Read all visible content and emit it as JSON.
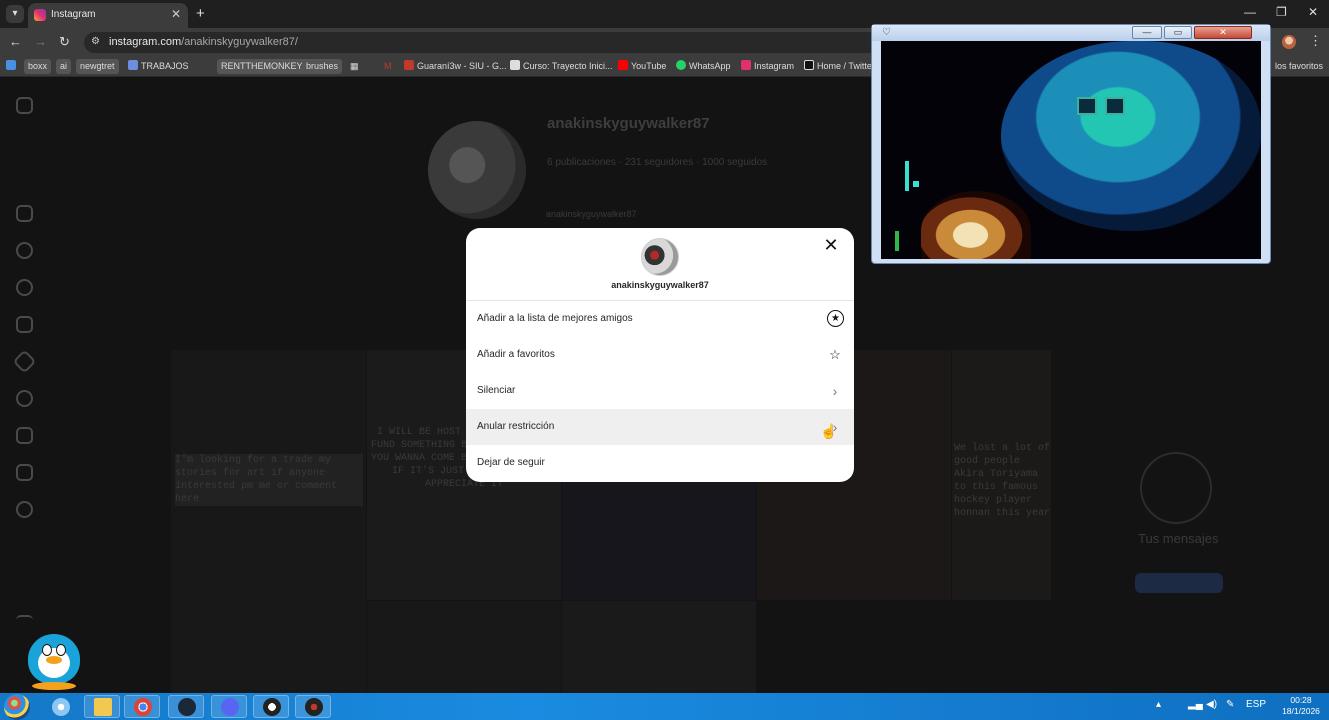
{
  "browser": {
    "tab_title": "Instagram",
    "url_host": "instagram.com",
    "url_path": "/anakinskyguywalker87/",
    "bookmarks": [
      {
        "label": "boxx",
        "chip": true,
        "color": "#3d7bd9"
      },
      {
        "label": "ai",
        "chip": true,
        "color": "#555"
      },
      {
        "label": "newgtret",
        "chip": true,
        "color": "#555"
      },
      {
        "label": "TRABAJOS",
        "chip": false,
        "color": "#6d8ddf"
      },
      {
        "label": "RENTTHEMONKEY",
        "chip": true,
        "color": "#ddd"
      },
      {
        "label": "brushes",
        "chip": true,
        "color": "#555"
      },
      {
        "label": "Guaraní3w - SIU - G...",
        "chip": false,
        "color": "#c0392b"
      },
      {
        "label": "Curso: Trayecto Inici...",
        "chip": false,
        "color": "#ddd"
      },
      {
        "label": "YouTube",
        "chip": false,
        "color": "#ff0000"
      },
      {
        "label": "WhatsApp",
        "chip": false,
        "color": "#25d366"
      },
      {
        "label": "Instagram",
        "chip": false,
        "color": "#e1306c"
      },
      {
        "label": "Home / Twitte",
        "chip": false,
        "color": "#111"
      }
    ],
    "bookmarks_overflow": "los favoritos"
  },
  "profile_bg": {
    "username": "anakinskyguywalker87",
    "stats": "6 publicaciones · 231 seguidores · 1000 seguidos",
    "highlight": "anakinskyguywalker87"
  },
  "grid_texts": {
    "post1": "I'm looking for a trade my stories for art if anyone interested pm me or comment here",
    "post2": "I WILL BE HOST STREAM ON CHAT FUND SOMETHING BUT I WANNA HELP YOU WANNA COME BY AND HELP EVEN IF IT'S JUST VIEWING I'D APPRECIATE IT",
    "post3": "We lost a lot of good people Akira Toriyama to this famous hockey player honnan this year"
  },
  "messages_bg": {
    "label": "Tus mensajes"
  },
  "modal": {
    "username": "anakinskyguywalker87",
    "options": [
      {
        "label": "Añadir a la lista de mejores amigos",
        "icon": "star-circle-icon"
      },
      {
        "label": "Añadir a favoritos",
        "icon": "star-outline-icon"
      },
      {
        "label": "Silenciar",
        "icon": "chevron-right-icon"
      },
      {
        "label": "Anular restricción",
        "icon": "chevron-right-icon"
      },
      {
        "label": "Dejar de seguir",
        "icon": ""
      }
    ],
    "hovered_index": 3
  },
  "taskbar": {
    "language": "ESP",
    "time": "00:28",
    "date": "18/1/2026"
  },
  "colors": {
    "taskbar": "#1578c8",
    "modal_bg": "#ffffff",
    "page_dim": "#131313"
  }
}
